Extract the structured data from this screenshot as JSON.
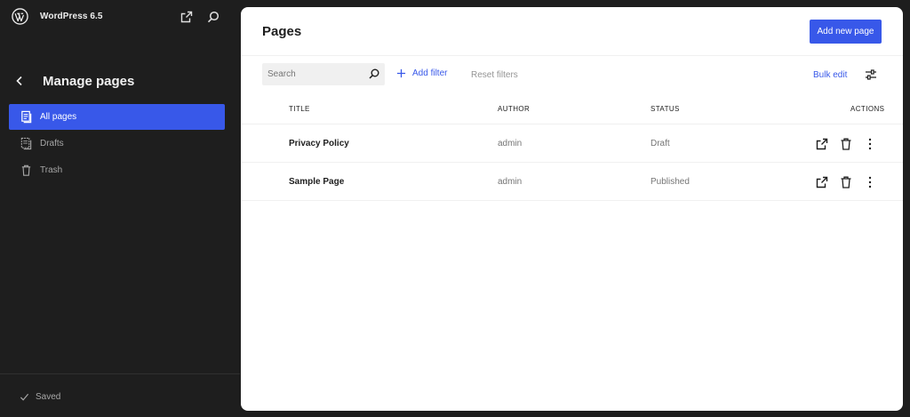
{
  "site": {
    "title": "WordPress 6.5"
  },
  "sidebar": {
    "heading": "Manage pages",
    "items": [
      {
        "label": "All pages",
        "icon": "pages-icon",
        "active": true
      },
      {
        "label": "Drafts",
        "icon": "drafts-icon",
        "active": false
      },
      {
        "label": "Trash",
        "icon": "trash-icon",
        "active": false
      }
    ],
    "footer_status": "Saved"
  },
  "main": {
    "title": "Pages",
    "add_new_label": "Add new page",
    "search_placeholder": "Search",
    "add_filter_label": "Add filter",
    "reset_filters_label": "Reset filters",
    "bulk_edit_label": "Bulk edit",
    "columns": [
      "TITLE",
      "AUTHOR",
      "STATUS",
      "ACTIONS"
    ],
    "rows": [
      {
        "title": "Privacy Policy",
        "author": "admin",
        "status": "Draft"
      },
      {
        "title": "Sample Page",
        "author": "admin",
        "status": "Published"
      }
    ]
  },
  "colors": {
    "accent": "#3858e9",
    "sidebar_bg": "#1e1e1e",
    "panel_bg": "#ffffff"
  }
}
